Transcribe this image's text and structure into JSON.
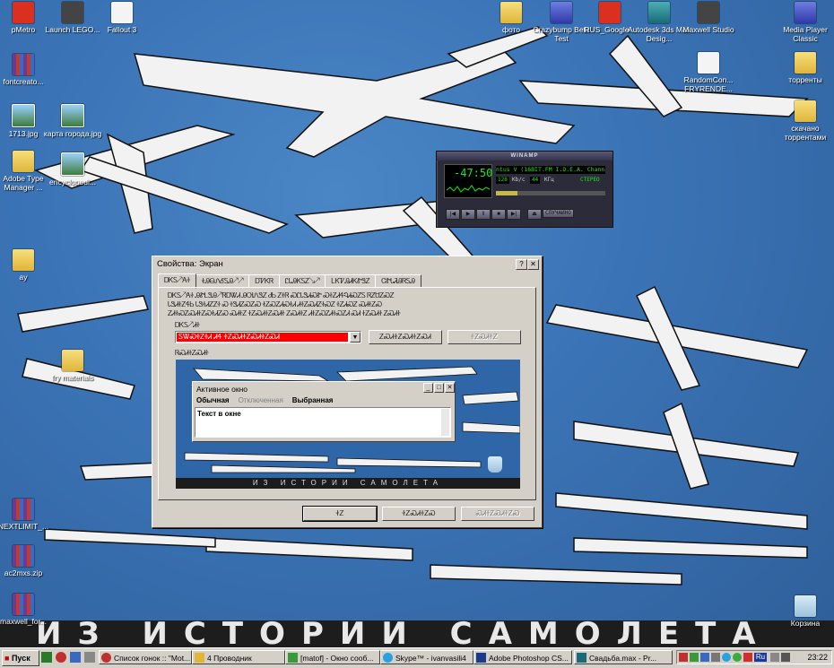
{
  "desktop": {
    "icons": [
      {
        "label": "pMetro",
        "glyph": "g-red"
      },
      {
        "label": "Launch LEGO...",
        "glyph": "g-dark"
      },
      {
        "label": "Fallout 3",
        "glyph": "g-white"
      },
      {
        "label": "фото",
        "glyph": "g-folder"
      },
      {
        "label": "Crazybump Beta Test",
        "glyph": "g-blue"
      },
      {
        "label": "RUS_Google...",
        "glyph": "g-red"
      },
      {
        "label": "Autodesk 3ds Max Desig...",
        "glyph": "g-teal"
      },
      {
        "label": "Maxwell Studio",
        "glyph": "g-dark"
      },
      {
        "label": "Media Player Classic",
        "glyph": "g-blue"
      },
      {
        "label": "fontcreato...",
        "glyph": "g-rar"
      },
      {
        "label": "RandomCon... FRYRENDE...",
        "glyph": "g-white"
      },
      {
        "label": "торренты",
        "glyph": "g-folder"
      },
      {
        "label": "1713.jpg",
        "glyph": "g-img"
      },
      {
        "label": "карта города.jpg",
        "glyph": "g-img"
      },
      {
        "label": "скачано торрентами",
        "glyph": "g-folder"
      },
      {
        "label": "Adobe Type Manager ...",
        "glyph": "g-folder"
      },
      {
        "label": "encyclopedi...",
        "glyph": "g-img"
      },
      {
        "label": "ay",
        "glyph": "g-folder"
      },
      {
        "label": "fry materials",
        "glyph": "g-folder"
      },
      {
        "label": "NEXTLIMIT_...",
        "glyph": "g-rar"
      },
      {
        "label": "ac2mxs.zip",
        "glyph": "g-rar"
      },
      {
        "label": "maxwell_for...",
        "glyph": "g-rar"
      },
      {
        "label": "Корзина",
        "glyph": "g-bin"
      }
    ],
    "wallpaper_caption": "ИЗ ИСТОРИИ САМОЛЕТА"
  },
  "winamp": {
    "title": "WINAMP",
    "time": "-47:50",
    "scroll_text": "ntus V (16BIT.FM I.D.E.A. Chann",
    "kbps": "128",
    "kbps_unit": "Kb/c",
    "khz": "44",
    "khz_unit": "KГц",
    "mode": "СТЕРЕО",
    "shuffle": "СЛУЧАЙНО",
    "position": 0.2
  },
  "dialog": {
    "title": "Свойства: Экран",
    "help_btn": "?",
    "close_btn": "✕",
    "tabs": [
      "ᎠᏦᏚ↗ᎪᏐ",
      "ᏐᎯᎾᏁᎴᏚᎯ↗↗",
      "ᎠᏤᏦᏒ",
      "ᏝᏓᎯᏦᏚᏃ↘↗",
      "ᏞᏦᏤᎯᏗᏦᏑᏕᏃ",
      "ᏣᏑᏓᏘᎯᏒᏚᎯ"
    ],
    "description_lines": [
      "ᎠᏦᏚ↗ᎪᏐ ᎯᏑᏞᏕᎯ↗ᏒᎠᏔᏗ ᎯᎺᏁᏕᏃ ᏧᏏ ᏃᏐᏒ ᏍᏝᏓᏕᏗᏍᏑ ᏍᏐᏃᏗᏎᏄᏗᏍᏃᏚ ᏒᏃᏌᏃᏍᏃ",
      "ᏓᏕᏗᏐᏃᏎᏏ ᏓᏕᏐᏗᏃᏃᏐ Ꮝ ᏐᏕᏗᏃᏍᏃᏍ ᏐᏃᏍᏃᏗᏍᏐᏗ ᏗᏐᏃᏍᏗᏃᏐᏍᏃ ᏐᏃᏗᏍᏃ ᏍᏗᏐᏃᏍ",
      "ᏃᏗᏐᏍᏃᏍᏗᏐᏃᏍᏐᏗᏃᏍ ᏍᏗᏐᏃ ᏐᏃᏍᏗᏐᏃᏍᏗᏐ ᏃᏍᏗᏐᏃ ᏗᏐᏃᏍᏃᏗᏐᏍᏃᏗ ᏍᏗ ᏐᏃᏍᏗᏐ ᏃᏍᏗᏐ"
    ],
    "element_label": "ᎠᏦᏚ↗ᏗᏐ",
    "element_value": "ᏚᏔᏍᏐᏃᏐᏗ ᏗᏎ ᏐᏃᏍᏗᏐᏃᏍᏗᏐᏃᏍᏗ",
    "save_as_btn": "ᏃᏍᏗᏐᏃᏍᏗᏐᏃᏍᏗ",
    "delete_btn": "ᏐᏃᏍᏗᏐᏃ",
    "sample_label": "ᏒᏍᏗᏐᏃᏍᏗᏐ",
    "preview": {
      "window_title": "Активное окно",
      "menu_normal": "Обычная",
      "menu_disabled": "Отключенная",
      "menu_selected": "Выбранная",
      "text": "Текст в окне",
      "band": "ИЗ ИСТОРИИ САМОЛЕТА"
    },
    "ok_btn": "ᏐᏃ",
    "cancel_btn": "ᏐᏃᏍᏗᏐᏃᏍ",
    "apply_btn": "ᏍᏗᏐᏃᏍᏗᏐᏃᏍ"
  },
  "taskbar": {
    "start": "Пуск",
    "tasks": [
      "Список гонок :: \"Mot...",
      "4 Проводник",
      "[matof] - Окно сооб...",
      "Skype™ - ivanvasili4",
      "Adobe Photoshop CS...",
      "Свадьба.max - Pr..."
    ],
    "tray_lang": "Ru",
    "clock": "23:22"
  }
}
